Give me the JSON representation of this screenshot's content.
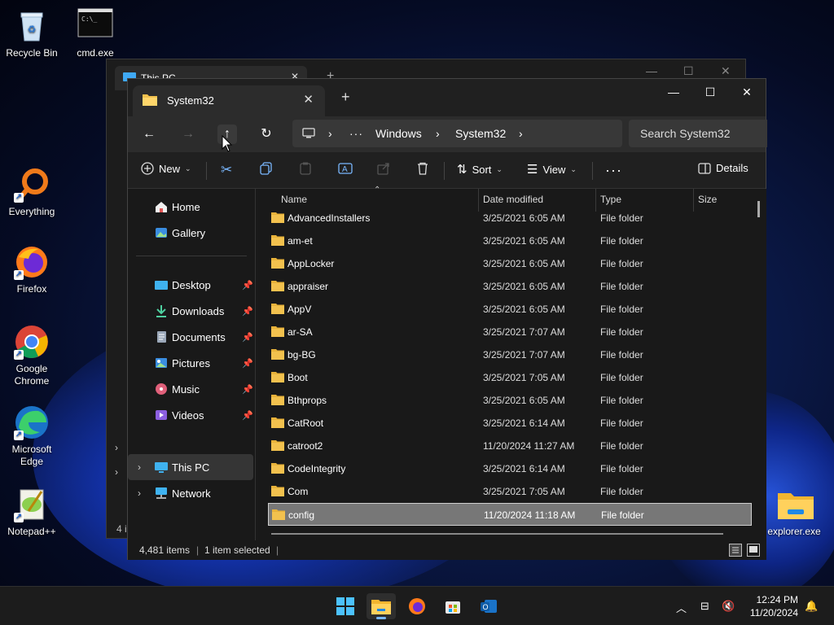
{
  "desktop": {
    "icons": [
      {
        "label": "Recycle Bin"
      },
      {
        "label": "cmd.exe"
      },
      {
        "label": "Everything"
      },
      {
        "label": "Firefox"
      },
      {
        "label": "Google Chrome"
      },
      {
        "label": "Microsoft Edge"
      },
      {
        "label": "Notepad++"
      },
      {
        "label": "explorer.exe"
      }
    ]
  },
  "background_window": {
    "tab_title": "This PC",
    "status_fragment": "4 i"
  },
  "window": {
    "tab_title": "System32",
    "search_placeholder": "Search System32",
    "breadcrumb": [
      "Windows",
      "System32"
    ],
    "toolbar": {
      "new_label": "New",
      "sort_label": "Sort",
      "view_label": "View",
      "details_label": "Details"
    },
    "nav": {
      "home": "Home",
      "gallery": "Gallery",
      "desktop": "Desktop",
      "downloads": "Downloads",
      "documents": "Documents",
      "pictures": "Pictures",
      "music": "Music",
      "videos": "Videos",
      "this_pc": "This PC",
      "network": "Network"
    },
    "columns": {
      "name": "Name",
      "date": "Date modified",
      "type": "Type",
      "size": "Size"
    },
    "files": [
      {
        "name": "AdvancedInstallers",
        "date": "3/25/2021 6:05 AM",
        "type": "File folder"
      },
      {
        "name": "am-et",
        "date": "3/25/2021 6:05 AM",
        "type": "File folder"
      },
      {
        "name": "AppLocker",
        "date": "3/25/2021 6:05 AM",
        "type": "File folder"
      },
      {
        "name": "appraiser",
        "date": "3/25/2021 6:05 AM",
        "type": "File folder"
      },
      {
        "name": "AppV",
        "date": "3/25/2021 6:05 AM",
        "type": "File folder"
      },
      {
        "name": "ar-SA",
        "date": "3/25/2021 7:07 AM",
        "type": "File folder"
      },
      {
        "name": "bg-BG",
        "date": "3/25/2021 7:07 AM",
        "type": "File folder"
      },
      {
        "name": "Boot",
        "date": "3/25/2021 7:05 AM",
        "type": "File folder"
      },
      {
        "name": "Bthprops",
        "date": "3/25/2021 6:05 AM",
        "type": "File folder"
      },
      {
        "name": "CatRoot",
        "date": "3/25/2021 6:14 AM",
        "type": "File folder"
      },
      {
        "name": "catroot2",
        "date": "11/20/2024 11:27 AM",
        "type": "File folder"
      },
      {
        "name": "CodeIntegrity",
        "date": "3/25/2021 6:14 AM",
        "type": "File folder"
      },
      {
        "name": "Com",
        "date": "3/25/2021 7:05 AM",
        "type": "File folder"
      },
      {
        "name": "config",
        "date": "11/20/2024 11:18 AM",
        "type": "File folder",
        "selected": true
      }
    ],
    "status": {
      "items": "4,481 items",
      "selected": "1 item selected"
    }
  },
  "taskbar": {
    "time": "12:24 PM",
    "date": "11/20/2024"
  },
  "colors": {
    "folder": "#f2c14e",
    "accent": "#7ab8ff",
    "selection": "#777777"
  }
}
